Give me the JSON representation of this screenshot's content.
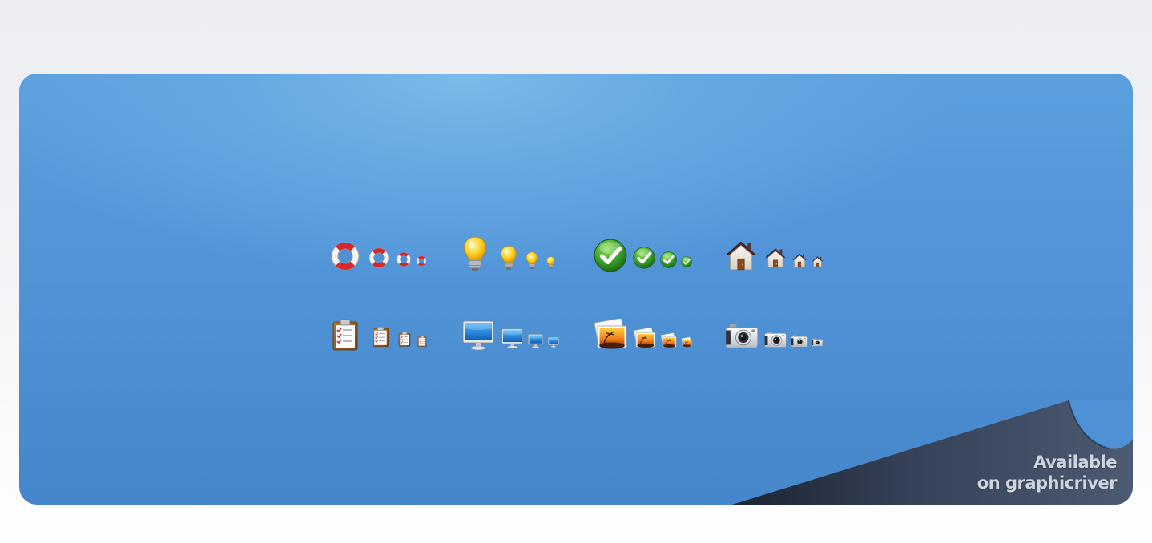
{
  "icon_sets": [
    {
      "row": 1,
      "icons": [
        "life-buoy-icon",
        "light-bulb-icon",
        "checkmark-icon",
        "home-icon"
      ]
    },
    {
      "row": 2,
      "icons": [
        "clipboard-checklist-icon",
        "monitor-icon",
        "photos-icon",
        "camera-icon"
      ]
    }
  ],
  "icon_sizes_per_set": 4,
  "call_to_action": {
    "line1": "Available",
    "line2": "on graphicriver"
  },
  "colors": {
    "banner_blue": "#4f91d5",
    "page_curl_dark": "#2b3444",
    "text_light": "#d7dde8"
  }
}
